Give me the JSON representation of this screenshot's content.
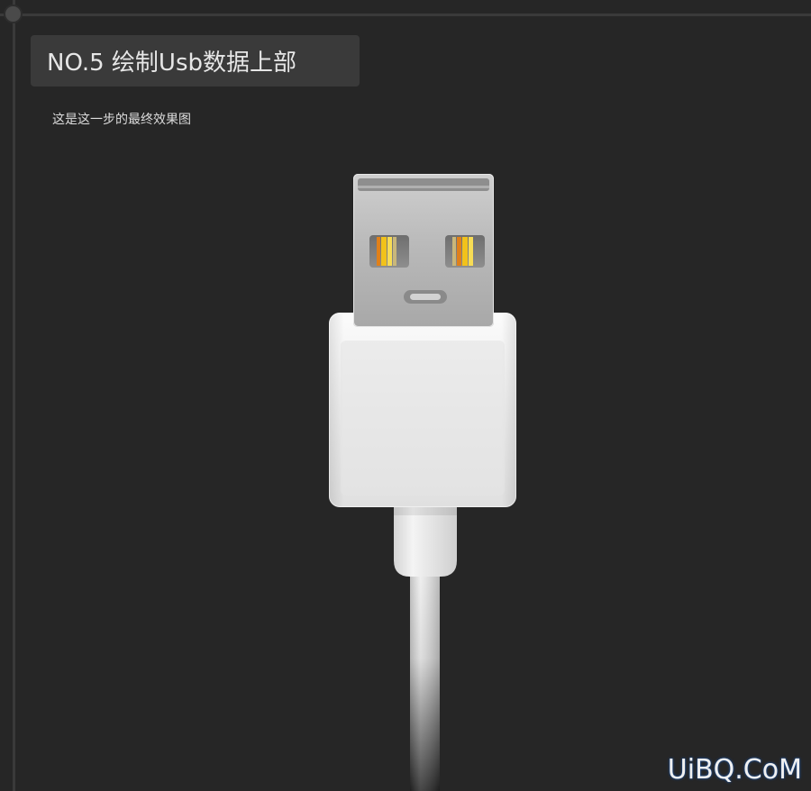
{
  "header": {
    "title": "NO.5 绘制Usb数据上部"
  },
  "caption": "这是这一步的最终效果图",
  "illustration": {
    "subject": "usb-cable-connector",
    "colors": {
      "background": "#262626",
      "plug_metal": "#b9b9b9",
      "housing": "#ececec",
      "contact_yellow": "#f2c21a",
      "contact_orange": "#e0801a"
    }
  },
  "watermark": "UiBQ.CoM"
}
